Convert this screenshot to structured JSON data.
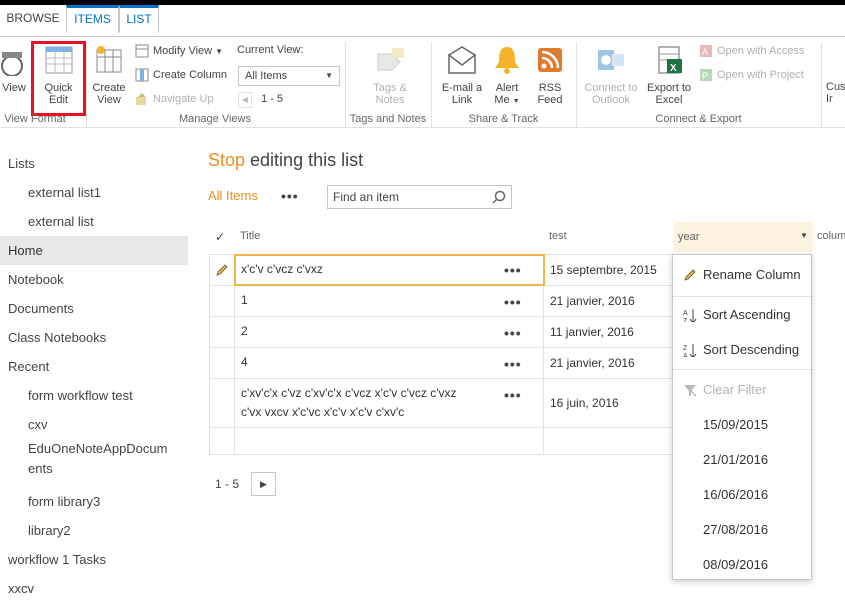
{
  "tabs": [
    {
      "label": "BROWSE"
    },
    {
      "label": "ITEMS"
    },
    {
      "label": "LIST"
    }
  ],
  "ribbon": {
    "view_label": "View",
    "quick_edit_label_1": "Quick",
    "quick_edit_label_2": "Edit",
    "view_format_group": "View Format",
    "create_view_label_1": "Create",
    "create_view_label_2": "View",
    "modify_view_label": "Modify View",
    "create_column_label": "Create Column",
    "navigate_up_label": "Navigate Up",
    "current_view_label": "Current View:",
    "current_view_value": "All Items",
    "paging_value": "1 - 5",
    "manage_views_group": "Manage Views",
    "tags_notes_label_1": "Tags &",
    "tags_notes_label_2": "Notes",
    "tags_notes_group": "Tags and Notes",
    "email_link_label_1": "E-mail a",
    "email_link_label_2": "Link",
    "alert_me_label_1": "Alert",
    "alert_me_label_2": "Me",
    "rss_label_1": "RSS",
    "rss_label_2": "Feed",
    "share_track_group": "Share & Track",
    "connect_outlook_label_1": "Connect to",
    "connect_outlook_label_2": "Outlook",
    "export_excel_label_1": "Export to",
    "export_excel_label_2": "Excel",
    "open_access_label": "Open with Access",
    "open_project_label": "Open with Project",
    "connect_export_group": "Connect & Export",
    "custom_label_1": "Cus",
    "custom_label_2": "Ir"
  },
  "nav": {
    "items": [
      {
        "label": "Lists",
        "sub": false
      },
      {
        "label": "external list1",
        "sub": true
      },
      {
        "label": "external list",
        "sub": true
      },
      {
        "label": "Home",
        "sub": false
      },
      {
        "label": "Notebook",
        "sub": false
      },
      {
        "label": "Documents",
        "sub": false
      },
      {
        "label": "Class Notebooks",
        "sub": false
      },
      {
        "label": "Recent",
        "sub": false
      },
      {
        "label": "form workflow test",
        "sub": true
      },
      {
        "label": "cxv",
        "sub": true
      },
      {
        "label": "EduOneNoteAppDocum",
        "sub": true
      },
      {
        "label": "ents",
        "sub": true
      },
      {
        "label": "form library3",
        "sub": true
      },
      {
        "label": "library2",
        "sub": true
      },
      {
        "label": "workflow 1 Tasks",
        "sub": false
      },
      {
        "label": "xxcv",
        "sub": false
      }
    ]
  },
  "main": {
    "title_stop": "Stop",
    "title_rest": " editing this list",
    "view_link": "All Items",
    "more": "•••",
    "search_placeholder": "Find an item",
    "columns": {
      "title": "Title",
      "test": "test",
      "year": "year",
      "column": "colum"
    },
    "rows": [
      {
        "title": "x'c'v c'vcz c'vxz",
        "test": "15 septembre, 2015"
      },
      {
        "title": "1",
        "test": "21 janvier, 2016"
      },
      {
        "title": "2",
        "test": "11 janvier, 2016"
      },
      {
        "title": "4",
        "test": "21 janvier, 2016"
      },
      {
        "title_1": "c'xv'c'x c'vz c'xv'c'x c'vcz x'c'v c'vcz c'vxz",
        "title_2": "c'vx vxcv x'c'vc x'c'v x'c'v c'xv'c",
        "test": "16 juin, 2016"
      }
    ],
    "paging": "1 - 5"
  },
  "menu": {
    "rename": "Rename Column",
    "sort_asc": "Sort Ascending",
    "sort_desc": "Sort Descending",
    "clear_filter": "Clear Filter",
    "values": [
      "15/09/2015",
      "21/01/2016",
      "16/06/2016",
      "27/08/2016",
      "08/09/2016"
    ]
  },
  "colors": {
    "accent": "#0072c6",
    "orange": "#ea8e21",
    "highlight_red": "#e81123"
  }
}
